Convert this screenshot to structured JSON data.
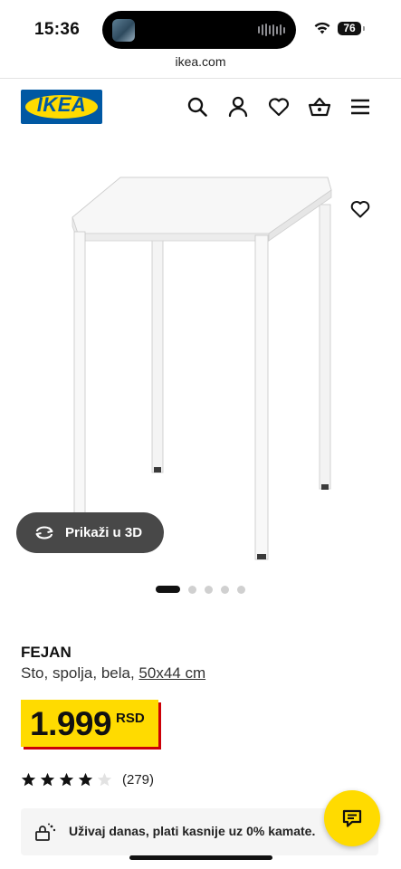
{
  "status_bar": {
    "time": "15:36",
    "battery_level": "76",
    "wifi_icon": "wifi-icon",
    "battery_icon": "battery-icon"
  },
  "browser": {
    "url": "ikea.com"
  },
  "header": {
    "logo_text": "IKEA",
    "brand_colors": {
      "blue": "#0058a3",
      "yellow": "#ffdb00"
    },
    "icons": [
      "search-icon",
      "account-icon",
      "wishlist-heart-icon",
      "cart-basket-icon",
      "menu-hamburger-icon"
    ]
  },
  "gallery": {
    "view_3d_label": "Prikaži u 3D",
    "slides_total": 5,
    "active_slide": 1,
    "favorite_icon": "heart-outline-icon"
  },
  "product": {
    "name": "FEJAN",
    "description": "Sto, spolja, bela, ",
    "size": "50x44 cm",
    "price": "1.999",
    "currency": "RSD",
    "rating_stars": 4,
    "rating_max": 5,
    "review_count": "(279)"
  },
  "promo": {
    "text": "Uživaj danas, plati kasnije uz 0% kamate.",
    "icon": "pay-later-icon"
  },
  "chat": {
    "icon": "chat-bubble-icon"
  }
}
